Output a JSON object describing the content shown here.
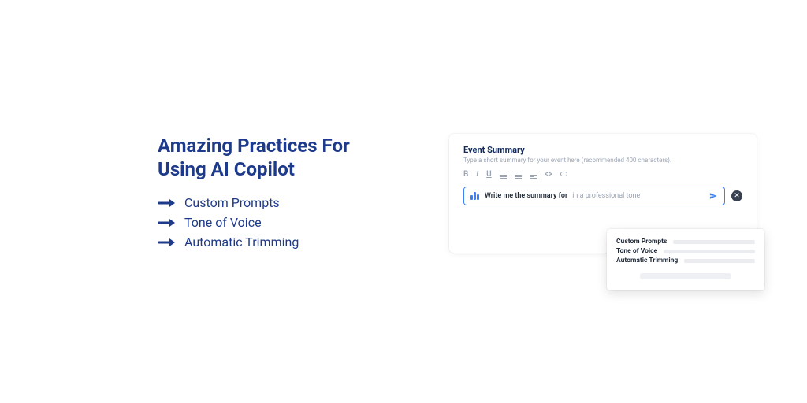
{
  "colors": {
    "brand": "#1e3a8a",
    "accent": "#3b82f6"
  },
  "left": {
    "headline": "Amazing Practices For Using AI Copilot",
    "bullets": [
      "Custom Prompts",
      "Tone of Voice",
      "Automatic Trimming"
    ]
  },
  "editor": {
    "section_title": "Event Summary",
    "section_subtitle": "Type a short summary for your event here (recommended 400 characters).",
    "toolbar": {
      "bold": "B",
      "italic": "I",
      "underline": "U",
      "code": "<>"
    },
    "prompt": {
      "main": "Write me the summary for",
      "hint": "in a professional tone"
    },
    "suggestions": [
      "Custom Prompts",
      "Tone of Voice",
      "Automatic Trimming"
    ]
  }
}
